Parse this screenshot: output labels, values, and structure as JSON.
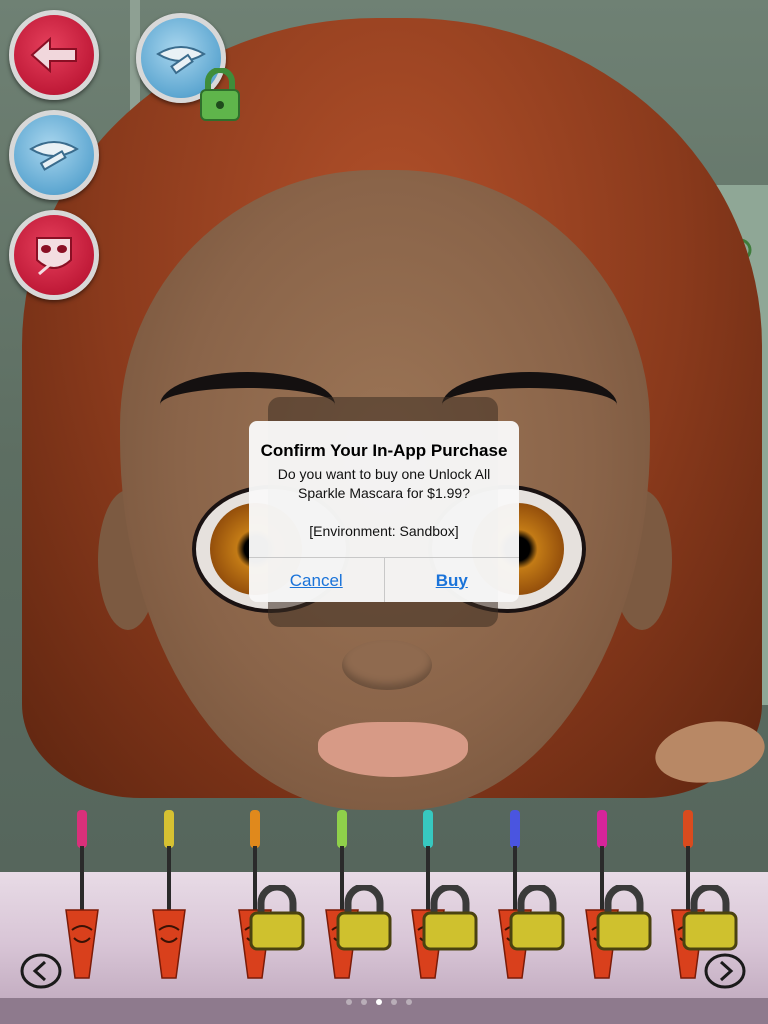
{
  "dialog": {
    "title": "Confirm Your In-App Purchase",
    "message": "Do you want to buy one Unlock All Sparkle Mascara for $1.99?\n\n[Environment: Sandbox]",
    "cancel_label": "Cancel",
    "buy_label": "Buy"
  },
  "side_buttons": [
    {
      "name": "back-arrow-icon",
      "color": "red"
    },
    {
      "name": "lipstick-icon",
      "color": "blue",
      "locked": true
    },
    {
      "name": "lips-brush-icon",
      "color": "blue"
    },
    {
      "name": "face-mask-icon",
      "color": "red"
    }
  ],
  "mascara_colors": [
    "#d9307a",
    "#d6c132",
    "#e0891c",
    "#8fd04a",
    "#37c8c0",
    "#4a55e0",
    "#d6249a",
    "#d94b1e"
  ],
  "mascara_locked": [
    false,
    false,
    true,
    true,
    true,
    true,
    true,
    true
  ],
  "pager": {
    "count": 5,
    "active": 2
  },
  "colors": {
    "accent": "#1a73d9",
    "button_red": "#c01a38",
    "button_blue": "#5ea7d1"
  }
}
